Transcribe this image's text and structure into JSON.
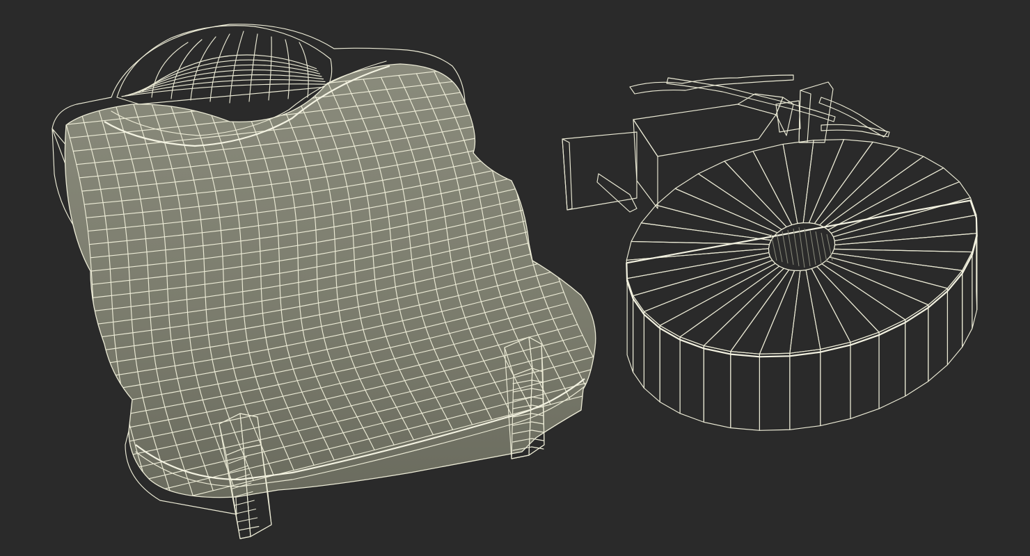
{
  "scene": {
    "background_color": "#2a2a2a",
    "mesh_color": "#7d7e6f",
    "mesh_shadow_color": "#5c5d51",
    "wire_color": "#ecebd6",
    "objects": [
      {
        "name": "rounded-pouch-mesh",
        "grid_rows": 30,
        "grid_cols": 24
      },
      {
        "name": "ring-disc-mesh",
        "radial_segments": 36
      }
    ]
  }
}
